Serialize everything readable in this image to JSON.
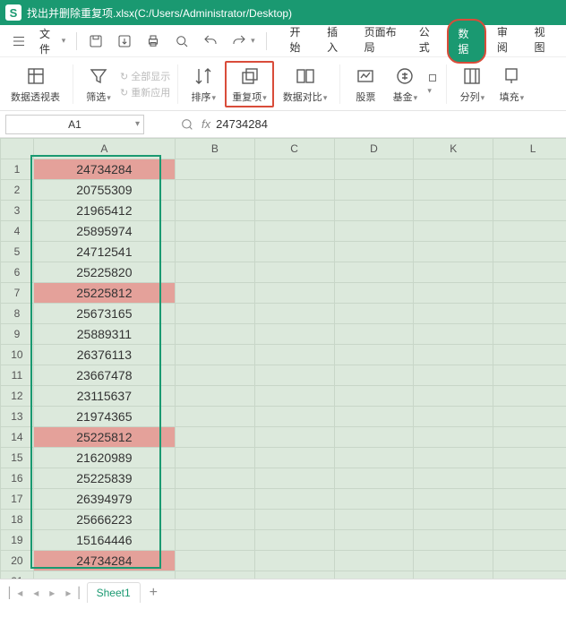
{
  "titlebar": {
    "app_initial": "S",
    "title": "找出并删除重复项.xlsx(C:/Users/Administrator/Desktop)"
  },
  "menubar": {
    "file_label": "文件",
    "tabs": {
      "start": "开始",
      "insert": "插入",
      "layout": "页面布局",
      "formula": "公式",
      "data": "数据",
      "review": "审阅",
      "view": "视图"
    }
  },
  "ribbon": {
    "pivot": "数据透视表",
    "filter": "筛选",
    "show_all": "全部显示",
    "reapply": "重新应用",
    "sort": "排序",
    "duplicates": "重复项",
    "data_compare": "数据对比",
    "stock": "股票",
    "fund": "基金",
    "text_to_cols": "分列",
    "fill": "填充"
  },
  "formula": {
    "namebox": "A1",
    "fx": "fx",
    "value": "24734284"
  },
  "columns": [
    "A",
    "B",
    "C",
    "D",
    "K",
    "L"
  ],
  "rows": [
    {
      "n": 1,
      "a": "24734284",
      "hl": true
    },
    {
      "n": 2,
      "a": "20755309",
      "hl": false
    },
    {
      "n": 3,
      "a": "21965412",
      "hl": false
    },
    {
      "n": 4,
      "a": "25895974",
      "hl": false
    },
    {
      "n": 5,
      "a": "24712541",
      "hl": false
    },
    {
      "n": 6,
      "a": "25225820",
      "hl": false
    },
    {
      "n": 7,
      "a": "25225812",
      "hl": true
    },
    {
      "n": 8,
      "a": "25673165",
      "hl": false
    },
    {
      "n": 9,
      "a": "25889311",
      "hl": false
    },
    {
      "n": 10,
      "a": "26376113",
      "hl": false
    },
    {
      "n": 11,
      "a": "23667478",
      "hl": false
    },
    {
      "n": 12,
      "a": "23115637",
      "hl": false
    },
    {
      "n": 13,
      "a": "21974365",
      "hl": false
    },
    {
      "n": 14,
      "a": "25225812",
      "hl": true
    },
    {
      "n": 15,
      "a": "21620989",
      "hl": false
    },
    {
      "n": 16,
      "a": "25225839",
      "hl": false
    },
    {
      "n": 17,
      "a": "26394979",
      "hl": false
    },
    {
      "n": 18,
      "a": "25666223",
      "hl": false
    },
    {
      "n": 19,
      "a": "15164446",
      "hl": false
    },
    {
      "n": 20,
      "a": "24734284",
      "hl": true
    },
    {
      "n": 21,
      "a": "",
      "hl": false
    }
  ],
  "sheettabs": {
    "sheet1": "Sheet1"
  }
}
